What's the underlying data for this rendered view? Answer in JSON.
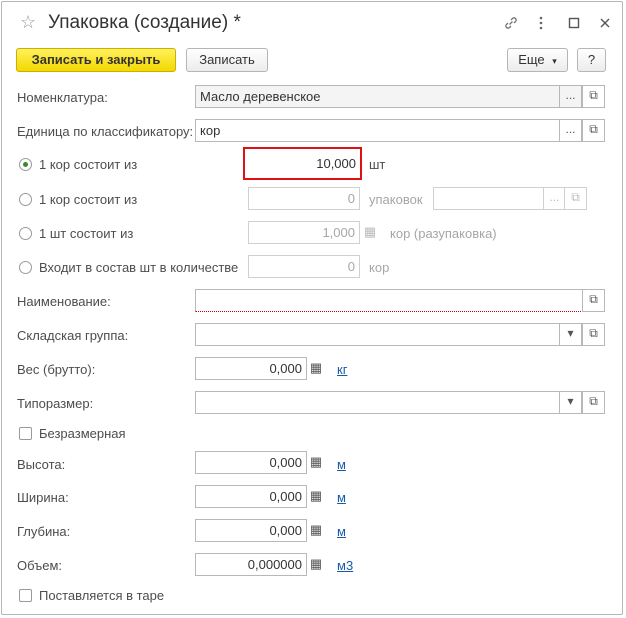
{
  "window": {
    "title": "Упаковка (создание) *"
  },
  "toolbar": {
    "save_close_label": "Записать и закрыть",
    "save_label": "Записать",
    "more_label": "Еще",
    "help_label": "?"
  },
  "form": {
    "nomenclature": {
      "label": "Номенклатура:",
      "value": "Масло деревенское"
    },
    "unit_classifier": {
      "label": "Единица по классификатору:",
      "value": "кор"
    },
    "option1": {
      "label": "1 кор состоит из",
      "value": "10,000",
      "unit": "шт"
    },
    "option2": {
      "label": "1 кор состоит из",
      "value": "0",
      "unit": "упаковок"
    },
    "option3": {
      "label": "1 шт состоит из",
      "value": "1,000",
      "unit": "кор (разупаковка)"
    },
    "option4": {
      "label": "Входит в состав шт в количестве",
      "value": "0",
      "unit": "кор"
    },
    "name": {
      "label": "Наименование:",
      "value": ""
    },
    "warehouse_group": {
      "label": "Складская группа:",
      "value": ""
    },
    "weight": {
      "label": "Вес (брутто):",
      "value": "0,000",
      "unit": "кг"
    },
    "size_type": {
      "label": "Типоразмер:",
      "value": ""
    },
    "dimensionless": {
      "label": "Безразмерная"
    },
    "height": {
      "label": "Высота:",
      "value": "0,000",
      "unit": "м"
    },
    "width": {
      "label": "Ширина:",
      "value": "0,000",
      "unit": "м"
    },
    "depth": {
      "label": "Глубина:",
      "value": "0,000",
      "unit": "м"
    },
    "volume": {
      "label": "Объем:",
      "value": "0,000000",
      "unit": "м3"
    },
    "in_container": {
      "label": "Поставляется в таре"
    }
  }
}
